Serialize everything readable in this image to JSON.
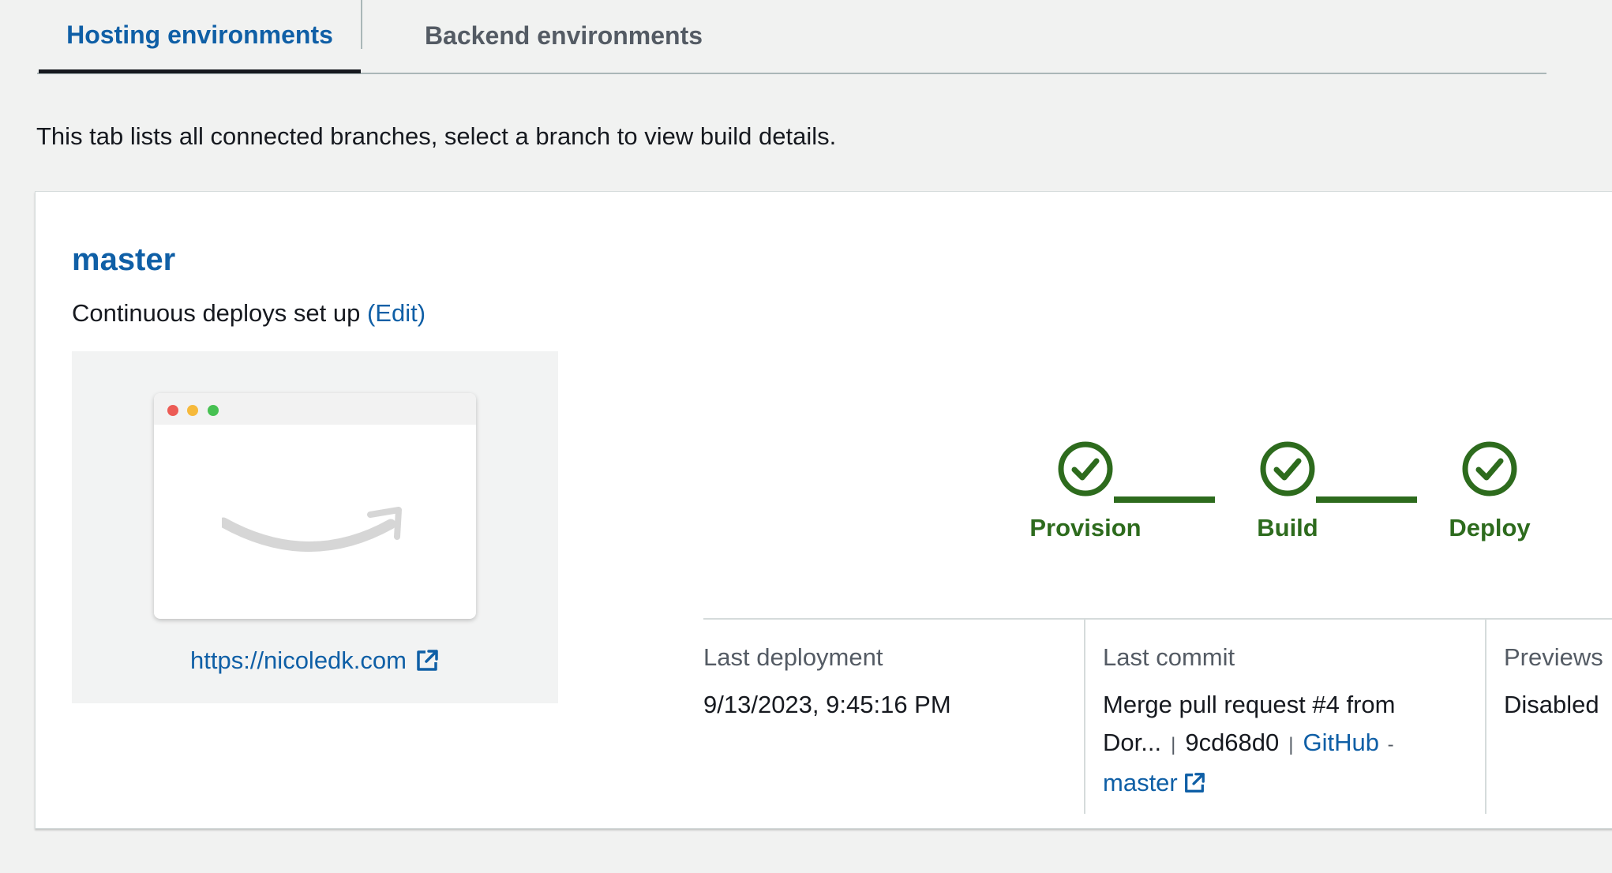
{
  "tabs": [
    {
      "label": "Hosting environments",
      "active": true
    },
    {
      "label": "Backend environments",
      "active": false
    }
  ],
  "intro_text": "This tab lists all connected branches, select a branch to view build details.",
  "branch": {
    "name": "master",
    "continuous_deploy_text": "Continuous deploys set up",
    "edit_label": "(Edit)",
    "site_url": "https://nicoledk.com"
  },
  "pipeline": {
    "steps": [
      {
        "label": "Provision",
        "status": "succeeded"
      },
      {
        "label": "Build",
        "status": "succeeded"
      },
      {
        "label": "Deploy",
        "status": "succeeded"
      }
    ],
    "color": "#2d6b1d"
  },
  "details": {
    "last_deployment": {
      "label": "Last deployment",
      "value": "9/13/2023, 9:45:16 PM"
    },
    "last_commit": {
      "label": "Last commit",
      "message": "Merge pull request #4 from Dor...",
      "hash": "9cd68d0",
      "source_link": "GitHub",
      "dash": "-",
      "branch_link": "master"
    },
    "previews": {
      "label": "Previews",
      "value": "Disabled"
    }
  },
  "colors": {
    "link": "#0f5fa6",
    "success": "#2d6b1d"
  },
  "icons": {
    "external_link": "external-link-icon",
    "check": "check-circle-icon"
  }
}
